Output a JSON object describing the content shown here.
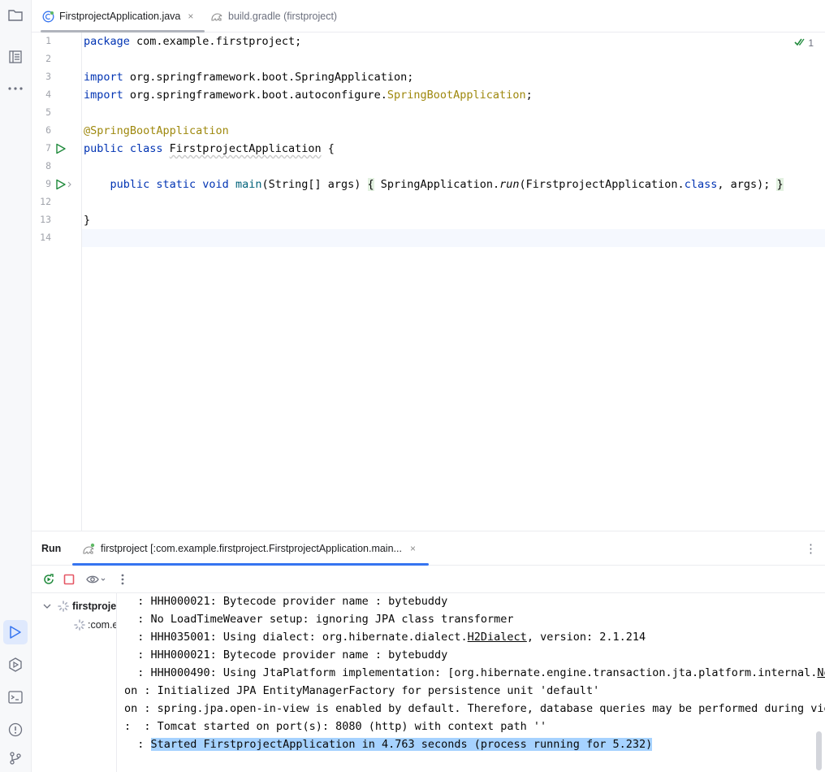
{
  "colors": {
    "keyword": "#0033b3",
    "annotation": "#9e880d",
    "method": "#00627a",
    "run_icon": "#208a3c",
    "stop_icon": "#e55765",
    "active_tab_underline": "#3574f0",
    "console_highlight": "#a6d2ff"
  },
  "left_toolbar": {
    "top": [
      {
        "icon": "project-folder-icon"
      },
      {
        "icon": "structure-icon"
      },
      {
        "icon": "more-tools-icon"
      }
    ],
    "bottom": [
      {
        "icon": "run-tool-icon",
        "active": true
      },
      {
        "icon": "services-icon"
      },
      {
        "icon": "terminal-icon"
      },
      {
        "icon": "problems-icon"
      },
      {
        "icon": "git-icon"
      }
    ]
  },
  "editor_tabs": [
    {
      "label": "FirstprojectApplication.java",
      "close": "×",
      "icon": "spring-class-icon",
      "active": true
    },
    {
      "label": "build.gradle (firstproject)",
      "icon": "gradle-icon",
      "active": false
    }
  ],
  "editor": {
    "inspection": {
      "icon": "check-icon",
      "count": "1"
    },
    "lines": [
      {
        "num": "1",
        "parts": [
          {
            "t": "package ",
            "c": "kw"
          },
          {
            "t": "com.example.firstproject;"
          }
        ]
      },
      {
        "num": "2",
        "parts": []
      },
      {
        "num": "3",
        "parts": [
          {
            "t": "import ",
            "c": "kw"
          },
          {
            "t": "org.springframework.boot.SpringApplication;"
          }
        ]
      },
      {
        "num": "4",
        "parts": [
          {
            "t": "import ",
            "c": "kw"
          },
          {
            "t": "org.springframework.boot.autoconfigure."
          },
          {
            "t": "SpringBootApplication",
            "c": "ann"
          },
          {
            "t": ";"
          }
        ]
      },
      {
        "num": "5",
        "parts": []
      },
      {
        "num": "6",
        "parts": [
          {
            "t": "@SpringBootApplication",
            "c": "ann"
          }
        ]
      },
      {
        "num": "7",
        "run": true,
        "parts": [
          {
            "t": "public class ",
            "c": "kw"
          },
          {
            "t": "FirstprojectApplication",
            "c": "squiggle"
          },
          {
            "t": " {"
          }
        ]
      },
      {
        "num": "8",
        "parts": []
      },
      {
        "num": "9",
        "run": true,
        "fold": true,
        "parts": [
          {
            "t": "    "
          },
          {
            "t": "public static void ",
            "c": "kw"
          },
          {
            "t": "main",
            "c": "fn"
          },
          {
            "t": "(String[] args) "
          },
          {
            "t": "{",
            "c": "fold"
          },
          {
            "t": " SpringApplication."
          },
          {
            "t": "run",
            "c": "it"
          },
          {
            "t": "(FirstprojectApplication."
          },
          {
            "t": "class",
            "c": "kw"
          },
          {
            "t": ", args); "
          },
          {
            "t": "}",
            "c": "fold"
          }
        ]
      },
      {
        "num": "12",
        "parts": []
      },
      {
        "num": "13",
        "parts": [
          {
            "t": "}"
          }
        ]
      },
      {
        "num": "14",
        "parts": [],
        "current": true
      }
    ]
  },
  "run_panel": {
    "title": "Run",
    "tab_label": "firstproject [:com.example.firstproject.FirstprojectApplication.main...",
    "tab_close": "×",
    "menu": "⋮",
    "toolbar": [
      {
        "icon": "rerun-icon"
      },
      {
        "icon": "stop-icon"
      },
      {
        "icon": "eye-icon"
      },
      {
        "icon": "more-options-icon"
      }
    ],
    "tree": [
      {
        "label": "firstproje",
        "level": 0
      },
      {
        "label": ":com.e",
        "level": 1
      }
    ],
    "console": [
      {
        "prefix": "  : ",
        "text": "HHH000021: Bytecode provider name : bytebuddy"
      },
      {
        "prefix": "  : ",
        "text": "No LoadTimeWeaver setup: ignoring JPA class transformer"
      },
      {
        "prefix": "  : ",
        "text": "HHH035001: Using dialect: org.hibernate.dialect.",
        "link": "H2Dialect",
        "after": ", version: 2.1.214"
      },
      {
        "prefix": "  : ",
        "text": "HHH000021: Bytecode provider name : bytebuddy"
      },
      {
        "prefix": "  : ",
        "text": "HHH000490: Using JtaPlatform implementation: [org.hibernate.engine.transaction.jta.platform.internal.",
        "link": "No"
      },
      {
        "prefix": "on : ",
        "text": "Initialized JPA EntityManagerFactory for persistence unit 'default'"
      },
      {
        "prefix": "on : ",
        "text": "spring.jpa.open-in-view is enabled by default. Therefore, database queries may be performed during view"
      },
      {
        "prefix": ":  : ",
        "text": "Tomcat started on port(s): 8080 (http) with context path ''"
      },
      {
        "prefix": "  : ",
        "text": "Started FirstprojectApplication in 4.763 seconds (process running for 5.232)",
        "highlight": true
      }
    ]
  }
}
